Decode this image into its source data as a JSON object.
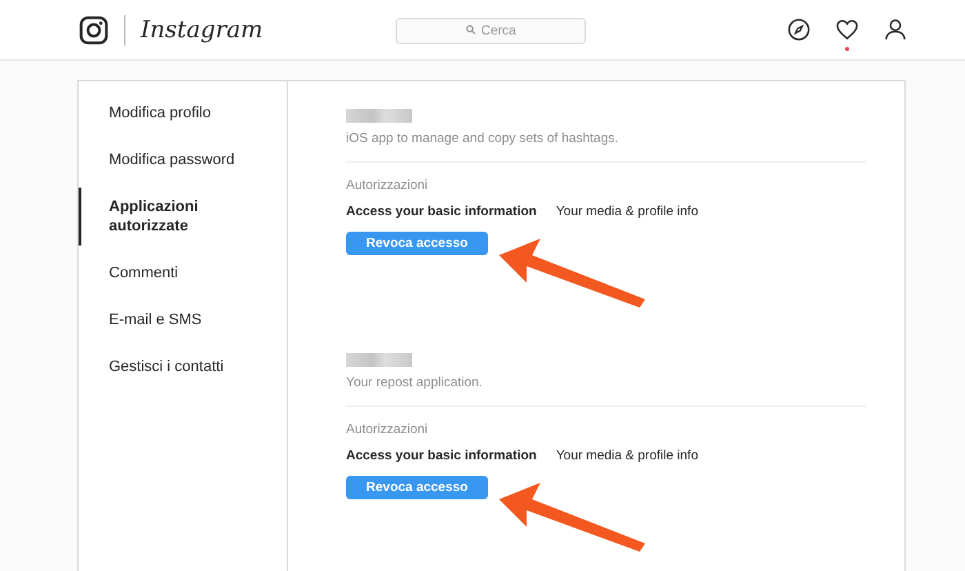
{
  "header": {
    "logo": "Instagram",
    "search": {
      "placeholder": "Cerca"
    },
    "notification_dot": true
  },
  "sidebar": {
    "items": [
      {
        "label": "Modifica profilo",
        "selected": false
      },
      {
        "label": "Modifica password",
        "selected": false
      },
      {
        "label": "Applicazioni autorizzate",
        "selected": true
      },
      {
        "label": "Commenti",
        "selected": false
      },
      {
        "label": "E-mail e SMS",
        "selected": false
      },
      {
        "label": "Gestisci i contatti",
        "selected": false
      }
    ]
  },
  "apps": [
    {
      "description": "iOS app to manage and copy sets of hashtags.",
      "permissions_title": "Autorizzazioni",
      "permission": "Access your basic information",
      "permission_detail": "Your media & profile info",
      "button": "Revoca accesso",
      "arrow": true
    },
    {
      "description": "Your repost application.",
      "permissions_title": "Autorizzazioni",
      "permission": "Access your basic information",
      "permission_detail": "Your media & profile info",
      "button": "Revoca accesso",
      "arrow": true
    }
  ]
}
